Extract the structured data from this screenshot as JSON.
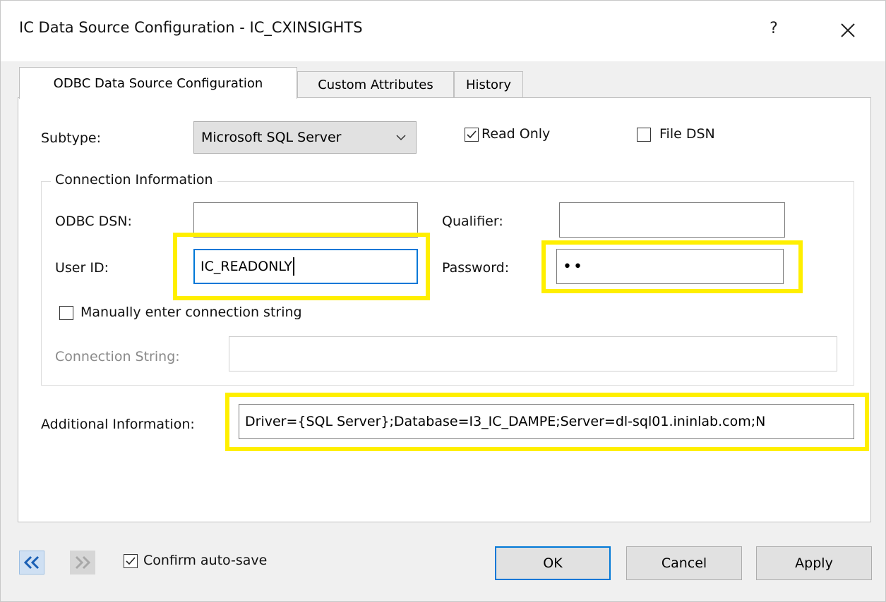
{
  "window": {
    "title": "IC Data Source Configuration - IC_CXINSIGHTS",
    "help_label": "?"
  },
  "tabs": [
    {
      "label": "ODBC Data Source Configuration",
      "active": true
    },
    {
      "label": "Custom Attributes",
      "active": false
    },
    {
      "label": "History",
      "active": false
    }
  ],
  "form": {
    "subtype_label": "Subtype:",
    "subtype_value": "Microsoft SQL Server",
    "read_only_label": "Read Only",
    "read_only_checked": true,
    "file_dsn_label": "File DSN",
    "file_dsn_checked": false,
    "group_title": "Connection Information",
    "odbc_dsn_label": "ODBC DSN:",
    "odbc_dsn_value": "",
    "qualifier_label": "Qualifier:",
    "qualifier_value": "",
    "user_id_label": "User ID:",
    "user_id_value": "IC_READONLY",
    "password_label": "Password:",
    "password_value": "••",
    "manual_conn_label": "Manually enter connection string",
    "manual_conn_checked": false,
    "conn_string_label": "Connection String:",
    "conn_string_value": "",
    "additional_info_label": "Additional Information:",
    "additional_info_value": "Driver={SQL Server};Database=I3_IC_DAMPE;Server=dl-sql01.ininlab.com;N"
  },
  "footer": {
    "confirm_autosave_label": "Confirm auto-save",
    "confirm_autosave_checked": true,
    "ok_label": "OK",
    "cancel_label": "Cancel",
    "apply_label": "Apply"
  },
  "colors": {
    "highlight": "#ffef00",
    "accent": "#0078d7"
  }
}
